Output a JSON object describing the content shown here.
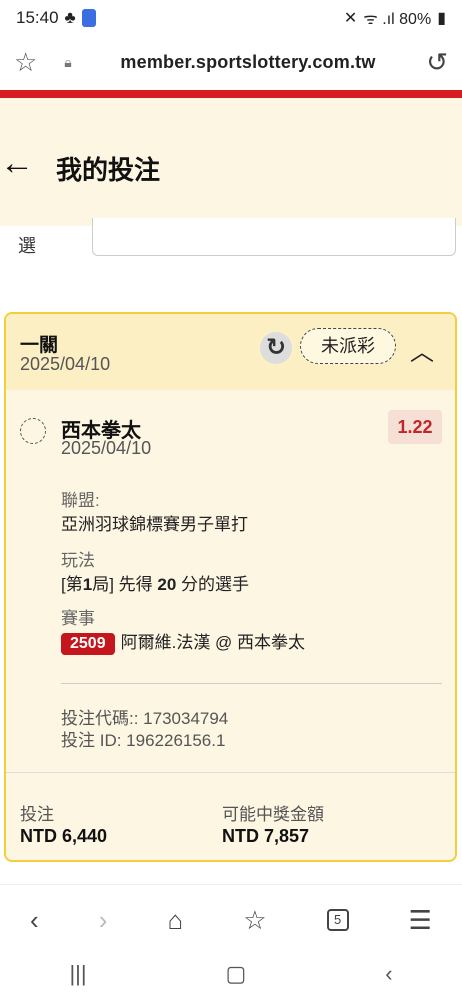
{
  "status_bar": {
    "time": "15:40",
    "right_text": "ᯤ .ıl 80%"
  },
  "browser": {
    "url": "member.sportslottery.com.tw"
  },
  "header": {
    "title": "我的投注"
  },
  "filter": {
    "label": "選"
  },
  "card": {
    "tier": "一關",
    "date": "2025/04/10",
    "status": "未派彩",
    "selection": {
      "name": "西本拳太",
      "date": "2025/04/10",
      "odds": "1.22"
    },
    "league_label": "聯盟:",
    "league_value": "亞洲羽球錦標賽男子單打",
    "market_label": "玩法",
    "market_value_prefix": "[第",
    "market_value_bold1": "1",
    "market_value_mid": "局] 先得 ",
    "market_value_bold2": "20",
    "market_value_suffix": " 分的選手",
    "event_label": "賽事",
    "event_id": "2509",
    "event_name": "阿爾維.法漢 @ 西本拳太",
    "bet_code": "投注代碼:: 173034794",
    "bet_id": "投注 ID: 196226156.1",
    "stake_label": "投注",
    "stake_value": "NTD 6,440",
    "payout_label": "可能中獎金額",
    "payout_value": "NTD 7,857"
  },
  "colors": {
    "accent_red": "#d71d24",
    "card_border": "#f2cf3b",
    "header_bg": "#fdf6e3"
  }
}
